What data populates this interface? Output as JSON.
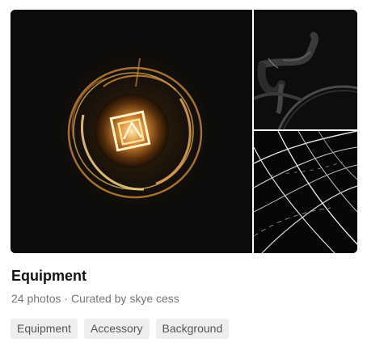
{
  "collection": {
    "title": "Equipment",
    "photo_count": "24 photos",
    "separator": "·",
    "curator": "Curated by skye cess",
    "tags": [
      "Equipment",
      "Accessory",
      "Background"
    ]
  },
  "photos": {
    "main": "lightbulb-filament-photo",
    "top_right": "bicycle-handlebar-photo",
    "bottom_right": "light-streaks-photo"
  },
  "colors": {
    "title": "#111111",
    "meta": "#767676",
    "tag_background": "#eeeeee",
    "tag_text": "#555555",
    "glow": "#f2b84b"
  }
}
